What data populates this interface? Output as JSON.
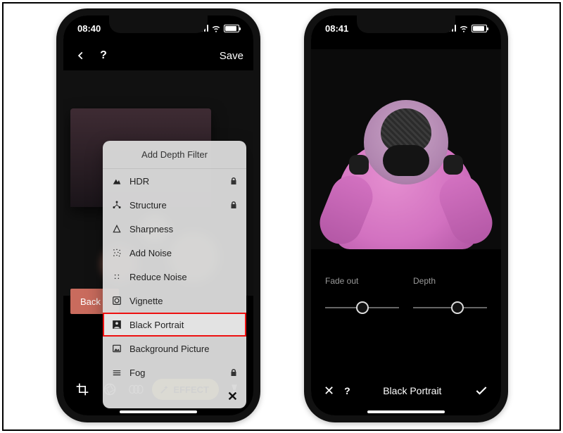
{
  "left": {
    "status": {
      "time": "08:40"
    },
    "header": {
      "save_label": "Save"
    },
    "back_label": "Back",
    "popup": {
      "title": "Add Depth Filter",
      "items": [
        {
          "icon": "mountain-icon",
          "label": "HDR",
          "locked": true
        },
        {
          "icon": "molecule-icon",
          "label": "Structure",
          "locked": true
        },
        {
          "icon": "triangle-icon",
          "label": "Sharpness",
          "locked": false
        },
        {
          "icon": "noise-icon",
          "label": "Add Noise",
          "locked": false
        },
        {
          "icon": "reduce-noise-icon",
          "label": "Reduce Noise",
          "locked": false
        },
        {
          "icon": "vignette-icon",
          "label": "Vignette",
          "locked": false
        },
        {
          "icon": "person-icon",
          "label": "Black Portrait",
          "locked": false,
          "highlight": true
        },
        {
          "icon": "picture-icon",
          "label": "Background Picture",
          "locked": false
        },
        {
          "icon": "fog-icon",
          "label": "Fog",
          "locked": true
        }
      ]
    },
    "toolbar": {
      "effect_label": "EFFECT"
    }
  },
  "right": {
    "status": {
      "time": "08:41"
    },
    "controls": {
      "fade": {
        "label": "Fade out",
        "value": 0.5
      },
      "depth": {
        "label": "Depth",
        "value": 0.6
      }
    },
    "bottom": {
      "title": "Black Portrait"
    }
  }
}
